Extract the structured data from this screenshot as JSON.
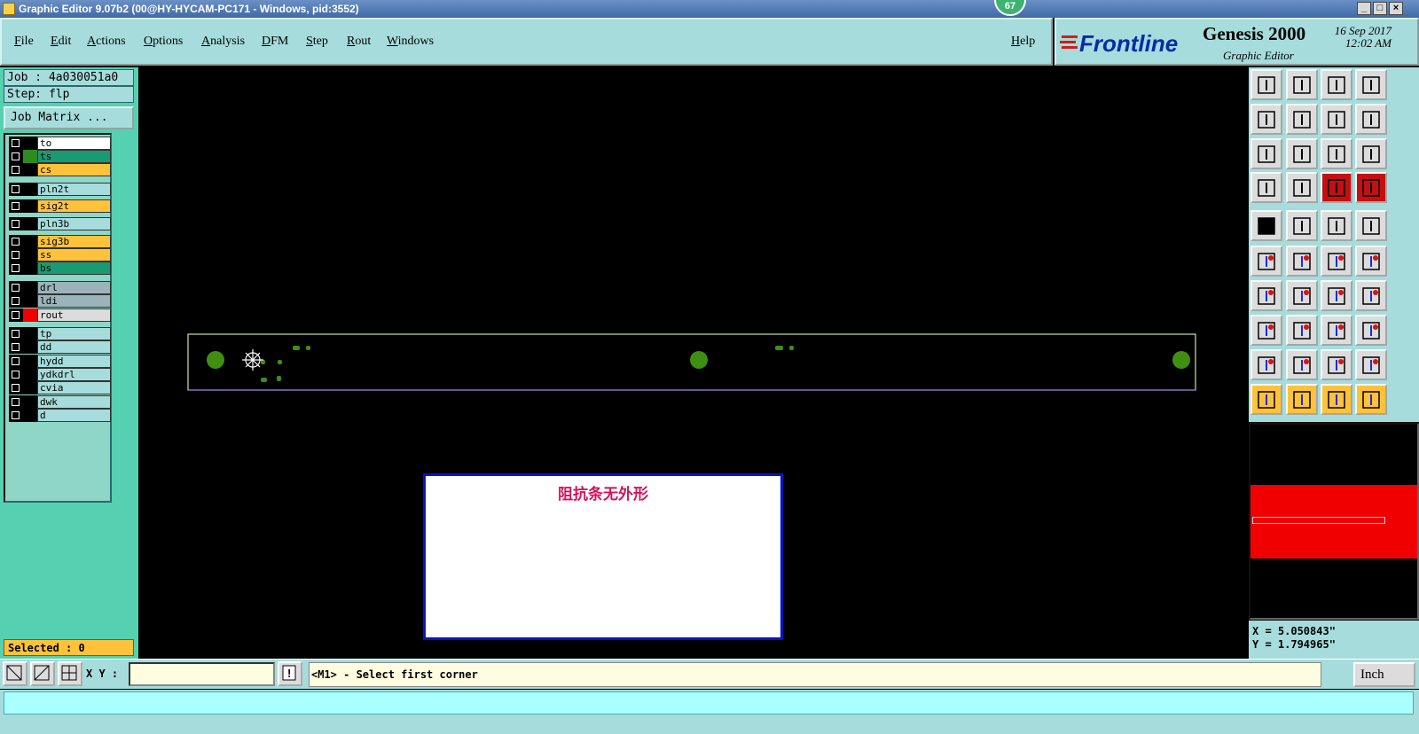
{
  "window": {
    "title": "Graphic Editor 9.07b2 (00@HY-HYCAM-PC171 - Windows, pid:3552)",
    "badge": "67"
  },
  "menu": {
    "file": "File",
    "edit": "Edit",
    "actions": "Actions",
    "options": "Options",
    "analysis": "Analysis",
    "dfm": "DFM",
    "step": "Step",
    "rout": "Rout",
    "windows": "Windows",
    "help": "Help"
  },
  "brand": {
    "logo": "Frontline",
    "product": "Genesis 2000",
    "subtitle": "Graphic Editor",
    "date": "16 Sep 2017",
    "time": "12:02 AM"
  },
  "job": {
    "job_label": "Job : 4a030051a0",
    "step_label": "Step: flp",
    "matrix_button": "Job Matrix ..."
  },
  "layers": [
    {
      "name": "to",
      "color": "#ffffff",
      "sw": "#000000"
    },
    {
      "name": "ts",
      "color": "#1a9a72",
      "sw": "#2e8b1f"
    },
    {
      "name": "cs",
      "color": "#ffc23a",
      "sw": "#000000"
    },
    {
      "name": "pln2t",
      "color": "#a6dcdc",
      "sw": "#000000"
    },
    {
      "name": "sig2t",
      "color": "#ffc23a",
      "sw": "#000000"
    },
    {
      "name": "pln3b",
      "color": "#a6dcdc",
      "sw": "#000000"
    },
    {
      "name": "sig3b",
      "color": "#ffc23a",
      "sw": "#000000"
    },
    {
      "name": "ss",
      "color": "#ffc23a",
      "sw": "#000000"
    },
    {
      "name": "bs",
      "color": "#1a9a72",
      "sw": "#000000"
    },
    {
      "name": "drl",
      "color": "#9ab4ba",
      "sw": "#000000"
    },
    {
      "name": "ldi",
      "color": "#9ab4ba",
      "sw": "#000000"
    },
    {
      "name": "rout",
      "color": "#dcdcdc",
      "sw": "#f10000"
    },
    {
      "name": "tp",
      "color": "#a6dcdc",
      "sw": "#000000"
    },
    {
      "name": "dd",
      "color": "#a6dcdc",
      "sw": "#000000"
    },
    {
      "name": "hydd",
      "color": "#a6dcdc",
      "sw": "#000000"
    },
    {
      "name": "ydkdrl",
      "color": "#a6dcdc",
      "sw": "#000000"
    },
    {
      "name": "cvia",
      "color": "#a6dcdc",
      "sw": "#000000"
    },
    {
      "name": "dwk",
      "color": "#a6dcdc",
      "sw": "#000000"
    },
    {
      "name": "d",
      "color": "#a6dcdc",
      "sw": "#000000"
    }
  ],
  "selected": "Selected : 0",
  "message": "阻抗条无外形",
  "coords": {
    "x": "X = 5.050843\"",
    "y": "Y = 1.794965\""
  },
  "status": {
    "xy_label": "X Y :",
    "xy_value": "",
    "prompt": "<M1> - Select first corner",
    "unit": "Inch"
  },
  "icons": [
    "move-up-icon",
    "move-down-icon",
    "home-icon",
    "window-icon",
    "move-left-icon",
    "move-right-icon",
    "undo-zoom-icon",
    "redraw-icon",
    "zoom-fit-icon",
    "zoom-center-icon",
    "ratio-icon",
    "help-icon",
    "wrench-icon",
    "grid-icon",
    "layer-a-icon",
    "layer-b-icon",
    "pad-icon",
    "select-area-icon",
    "ruler-icon",
    "feature-icon",
    "connect-icon",
    "cross-icon",
    "snap-a-icon",
    "snap-b-icon",
    "angle-a-icon",
    "angle-b-icon",
    "rotate-icon",
    "mirror-icon",
    "snap-c-icon",
    "line-icon",
    "measure-icon",
    "snap-d-icon",
    "tri-a-icon",
    "tri-b-icon",
    "tri-c-icon",
    "tri-d-icon",
    "pointer-icon",
    "pointer-b-icon",
    "pointer-c-icon",
    "pointer-d-icon"
  ]
}
